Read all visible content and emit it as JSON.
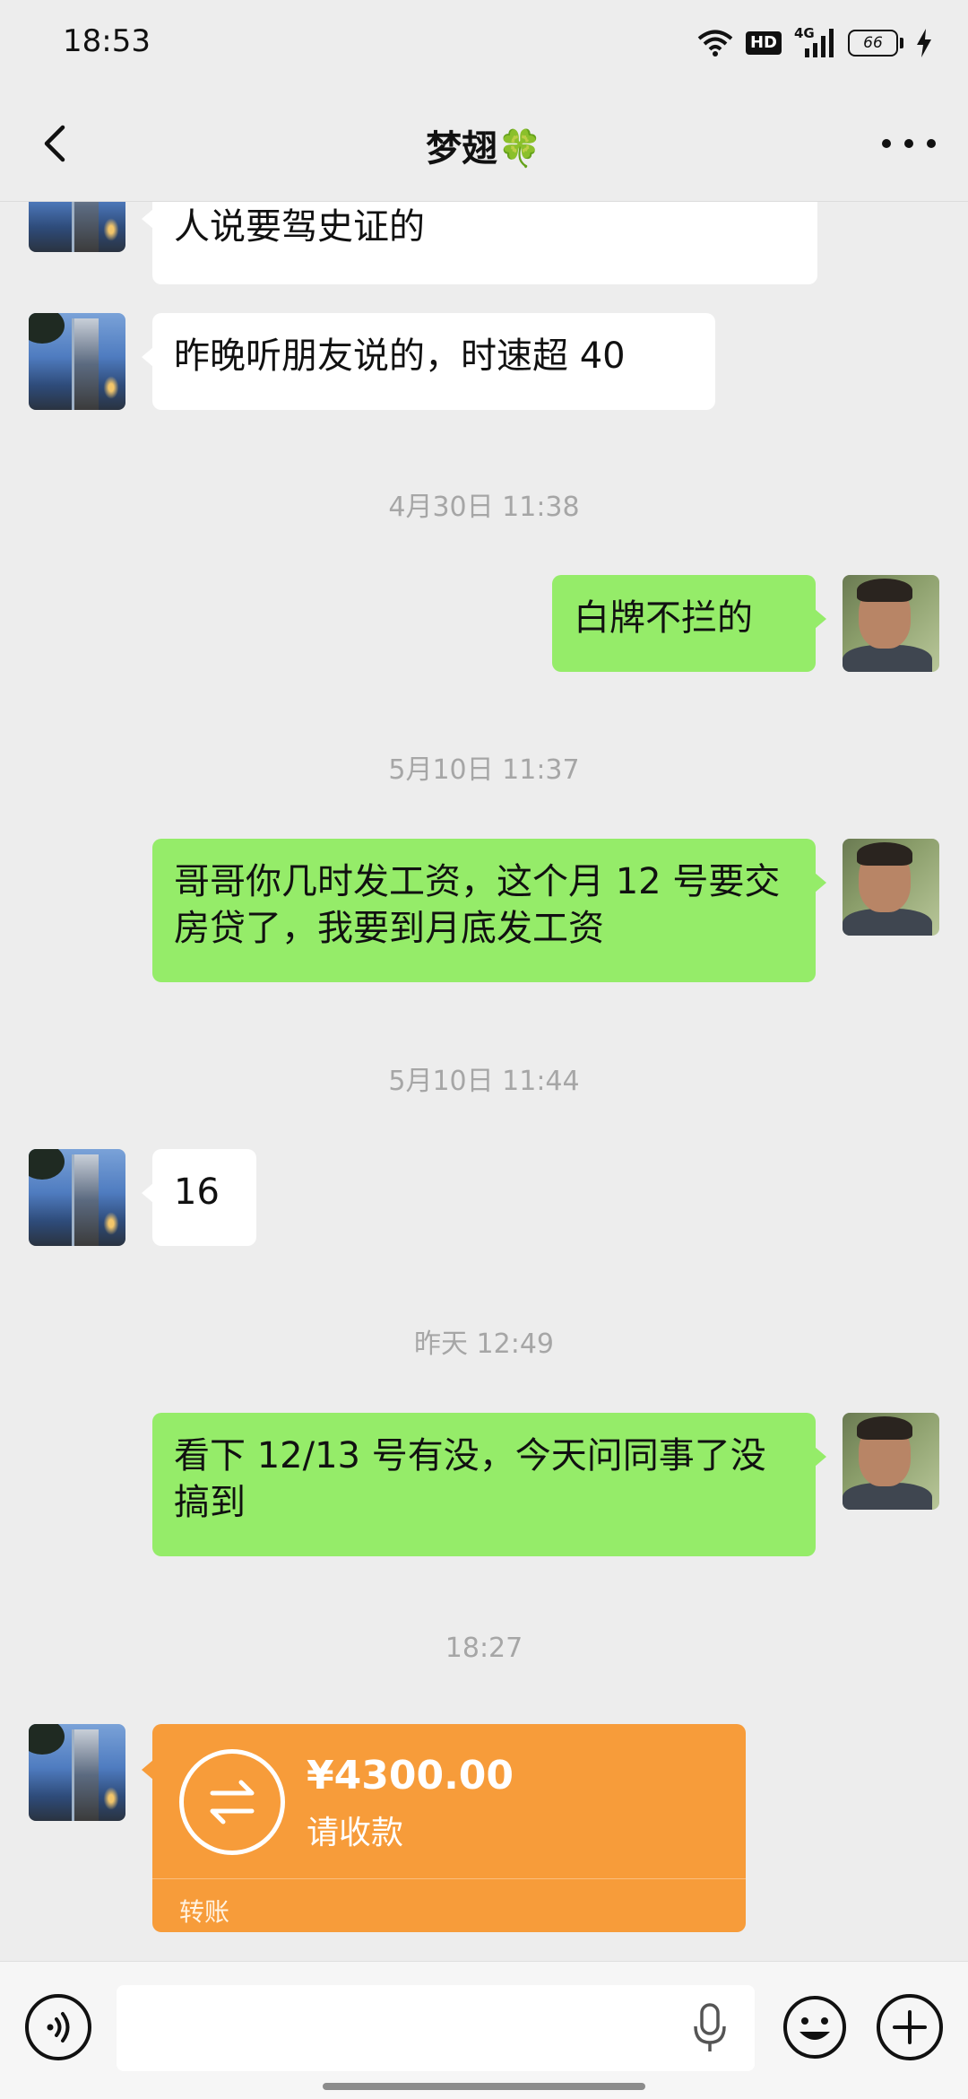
{
  "status_bar": {
    "time": "18:53",
    "network": "4G",
    "hd": "HD",
    "battery": "66"
  },
  "header": {
    "title": "梦翅",
    "title_emoji": "🍀"
  },
  "messages": [
    {
      "sender": "other",
      "text": "人说要驾史证的",
      "partial": true
    },
    {
      "sender": "other",
      "text": "昨晚听朋友说的，时速超 40"
    },
    {
      "type": "timestamp",
      "text": "4月30日 11:38"
    },
    {
      "sender": "self",
      "text": "白牌不拦的"
    },
    {
      "type": "timestamp",
      "text": "5月10日 11:37"
    },
    {
      "sender": "self",
      "text": "哥哥你几时发工资，这个月 12 号要交房贷了，我要到月底发工资"
    },
    {
      "type": "timestamp",
      "text": "5月10日 11:44"
    },
    {
      "sender": "other",
      "text": "16"
    },
    {
      "type": "timestamp",
      "text": "昨天 12:49"
    },
    {
      "sender": "self",
      "text": "看下 12/13 号有没，今天问同事了没搞到"
    },
    {
      "type": "timestamp",
      "text": "18:27"
    }
  ],
  "transfer": {
    "amount": "¥4300.00",
    "status": "请收款",
    "label": "转账",
    "color": "#f79c3a"
  },
  "input": {
    "value": "",
    "placeholder": ""
  },
  "icons": {
    "back": "back-arrow-icon",
    "more": "more-dots-icon",
    "voice": "voice-icon",
    "mic": "mic-icon",
    "emoji": "emoji-icon",
    "plus": "plus-icon",
    "transfer": "transfer-arrows-icon"
  },
  "colors": {
    "background": "#ededed",
    "self_bubble": "#95ec69",
    "other_bubble": "#ffffff",
    "timestamp": "#a6a6a6"
  }
}
